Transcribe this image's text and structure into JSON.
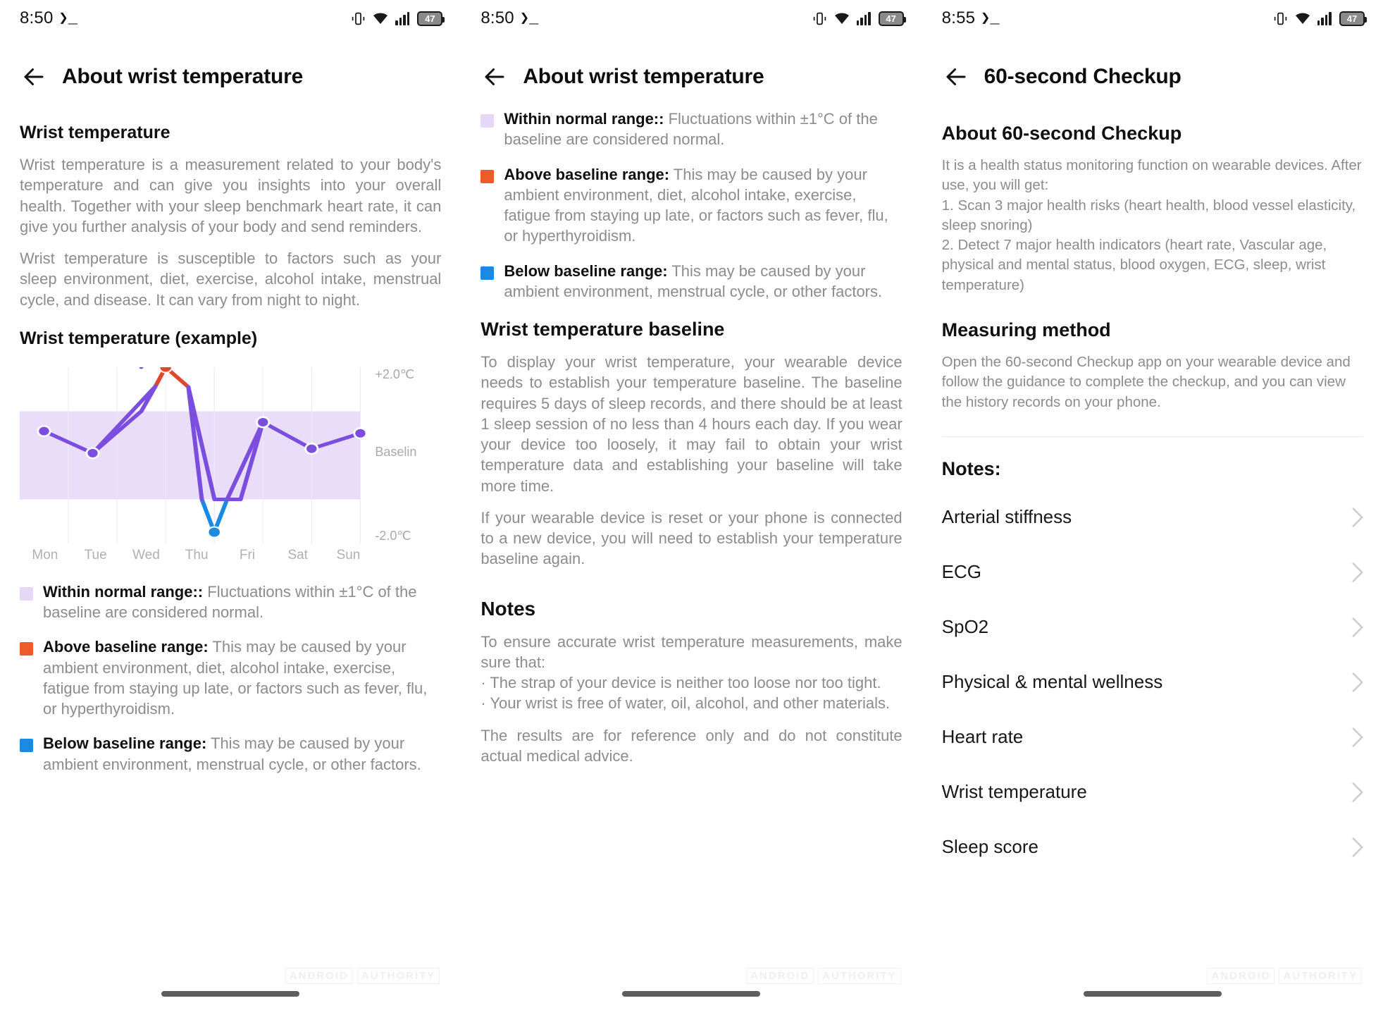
{
  "screens": [
    {
      "status": {
        "time": "8:50",
        "shell": "❯_",
        "battery": "47"
      },
      "appbar": {
        "title": "About wrist temperature",
        "back_icon": "back-arrow-icon"
      },
      "s1_heading": "Wrist temperature",
      "s1_para1": "Wrist temperature is a measurement related to your body's temperature and can give you insights into your overall health. Together with your sleep benchmark heart rate, it can give you further analysis of your body and send reminders.",
      "s1_para2": "Wrist temperature is susceptible to factors such as your sleep environment, diet, exercise, alcohol intake, menstrual cycle, and disease. It can vary from night to night.",
      "chart_heading": "Wrist temperature (example)",
      "legend": [
        {
          "swatch": "#e6d7f7",
          "bold": "Within normal range::",
          "rest": " Fluctuations within ±1°C of the baseline are considered normal."
        },
        {
          "swatch": "#ee5b2b",
          "bold": "Above baseline range:",
          "rest": " This may be caused by your ambient environment, diet, alcohol intake, exercise, fatigue from staying up late, or factors such as fever, flu, or hyperthyroidism."
        },
        {
          "swatch": "#1a8ae5",
          "bold": "Below baseline range:",
          "rest": " This may be caused by your ambient environment, menstrual cycle, or other factors."
        }
      ],
      "watermark": [
        "ANDROID",
        "AUTHORITY"
      ]
    },
    {
      "status": {
        "time": "8:50",
        "shell": "❯_",
        "battery": "47"
      },
      "appbar": {
        "title": "About wrist temperature",
        "back_icon": "back-arrow-icon"
      },
      "legend": [
        {
          "swatch": "#e6d7f7",
          "bold": "Within normal range::",
          "rest": " Fluctuations within ±1°C of the baseline are considered normal."
        },
        {
          "swatch": "#ee5b2b",
          "bold": "Above baseline range:",
          "rest": " This may be caused by your ambient environment, diet, alcohol intake, exercise, fatigue from staying up late, or factors such as fever, flu, or hyperthyroidism."
        },
        {
          "swatch": "#1a8ae5",
          "bold": "Below baseline range:",
          "rest": " This may be caused by your ambient environment, menstrual cycle, or other factors."
        }
      ],
      "baseline_heading": "Wrist temperature baseline",
      "baseline_para1": "To display your wrist temperature, your wearable device needs to establish your temperature baseline. The baseline requires 5 days of sleep records, and there should be at least 1 sleep session of no less than 4 hours each day. If you wear your device too loosely, it may fail to obtain your wrist temperature data and establishing your baseline will take more time.",
      "baseline_para2": "If your wearable device is reset or your phone is connected to a new device, you will need to establish your temperature baseline again.",
      "notes_heading": "Notes",
      "notes_para1": "To ensure accurate wrist temperature measurements, make sure that:\n· The strap of your device is neither too loose nor too tight.\n· Your wrist is free of water, oil, alcohol, and other materials.",
      "notes_para2": "The results are for reference only and do not constitute actual medical advice.",
      "watermark": [
        "ANDROID",
        "AUTHORITY"
      ]
    },
    {
      "status": {
        "time": "8:55",
        "shell": "❯_",
        "battery": "47"
      },
      "appbar": {
        "title": "60-second Checkup",
        "back_icon": "back-arrow-icon"
      },
      "about_heading": "About 60-second Checkup",
      "about_para": "It is a health status monitoring function on wearable devices. After use, you will get:\n1. Scan 3 major health risks (heart health, blood vessel elasticity, sleep snoring)\n2. Detect 7 major health indicators (heart rate, Vascular age, physical and mental status, blood oxygen, ECG, sleep, wrist temperature)",
      "method_heading": "Measuring method",
      "method_para": "Open the 60-second Checkup app on your wearable device and follow the guidance to complete the checkup, and you can view the history records on your phone.",
      "notes_heading": "Notes:",
      "list": [
        "Arterial stiffness",
        "ECG",
        "SpO2",
        "Physical & mental wellness",
        "Heart rate",
        "Wrist temperature",
        "Sleep score"
      ],
      "watermark": [
        "ANDROID",
        "AUTHORITY"
      ]
    }
  ],
  "chart_data": {
    "type": "line",
    "title": "Wrist temperature (example)",
    "categories": [
      "Mon",
      "Tue",
      "Wed",
      "Thu",
      "Fri",
      "Sat",
      "Sun"
    ],
    "values": [
      0.55,
      0.05,
      2.0,
      -1.75,
      0.75,
      0.1,
      0.5
    ],
    "point_colors": [
      "#7b4ee0",
      "#7b4ee0",
      "#e0482b",
      "#1a8ae5",
      "#7b4ee0",
      "#7b4ee0",
      "#7b4ee0"
    ],
    "ylabel": "",
    "xlabel": "",
    "ylim": [
      -2.0,
      2.0
    ],
    "y_tick_labels": [
      "+2.0℃",
      "Baselin",
      "-2.0℃"
    ],
    "normal_band": [
      -1.0,
      1.0
    ],
    "normal_band_color": "#e9ddfa",
    "line_color": "#7b4ee0",
    "above_color": "#e0482b",
    "below_color": "#1a8ae5",
    "grid": true,
    "legend_position": "below"
  }
}
